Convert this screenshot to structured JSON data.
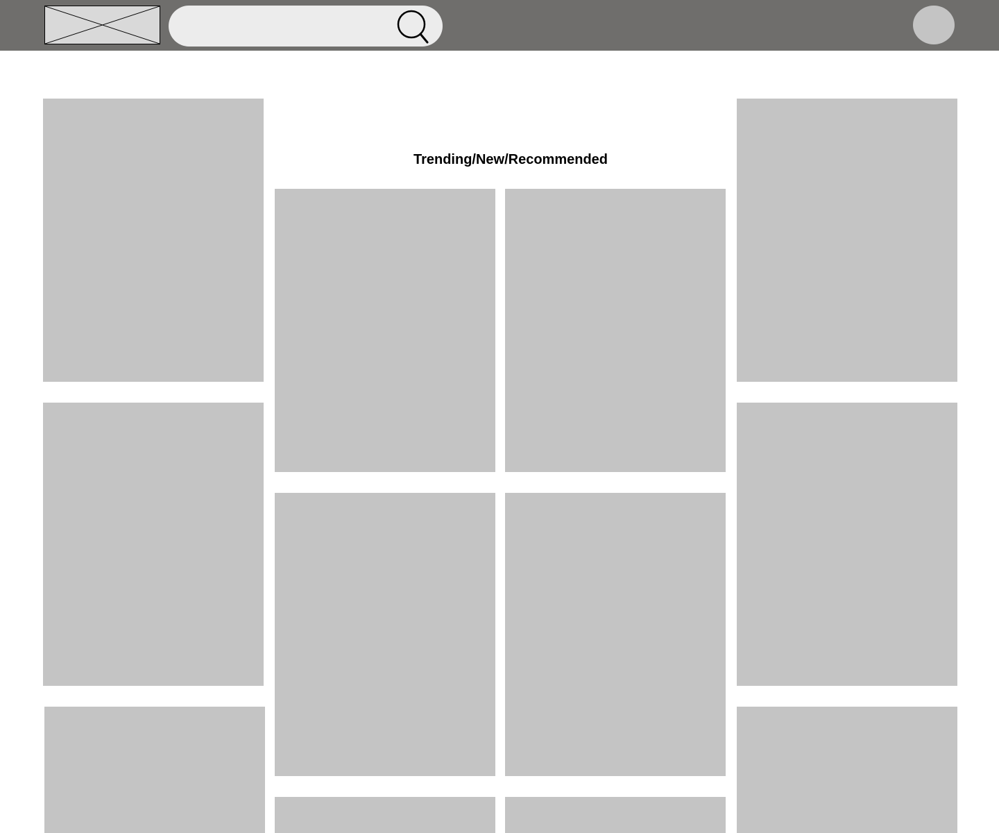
{
  "header": {
    "logo_icon": "image-placeholder-icon",
    "search": {
      "placeholder": "",
      "value": "",
      "icon": "search-icon"
    },
    "avatar_icon": "avatar"
  },
  "main": {
    "section_title": "Trending/New/Recommended"
  },
  "colors": {
    "topbar": "#6f6e6c",
    "search_field": "#ececec",
    "placeholder_card": "#c4c4c4",
    "avatar": "#c4c4c4",
    "logo_placeholder": "#d9d9d9"
  }
}
